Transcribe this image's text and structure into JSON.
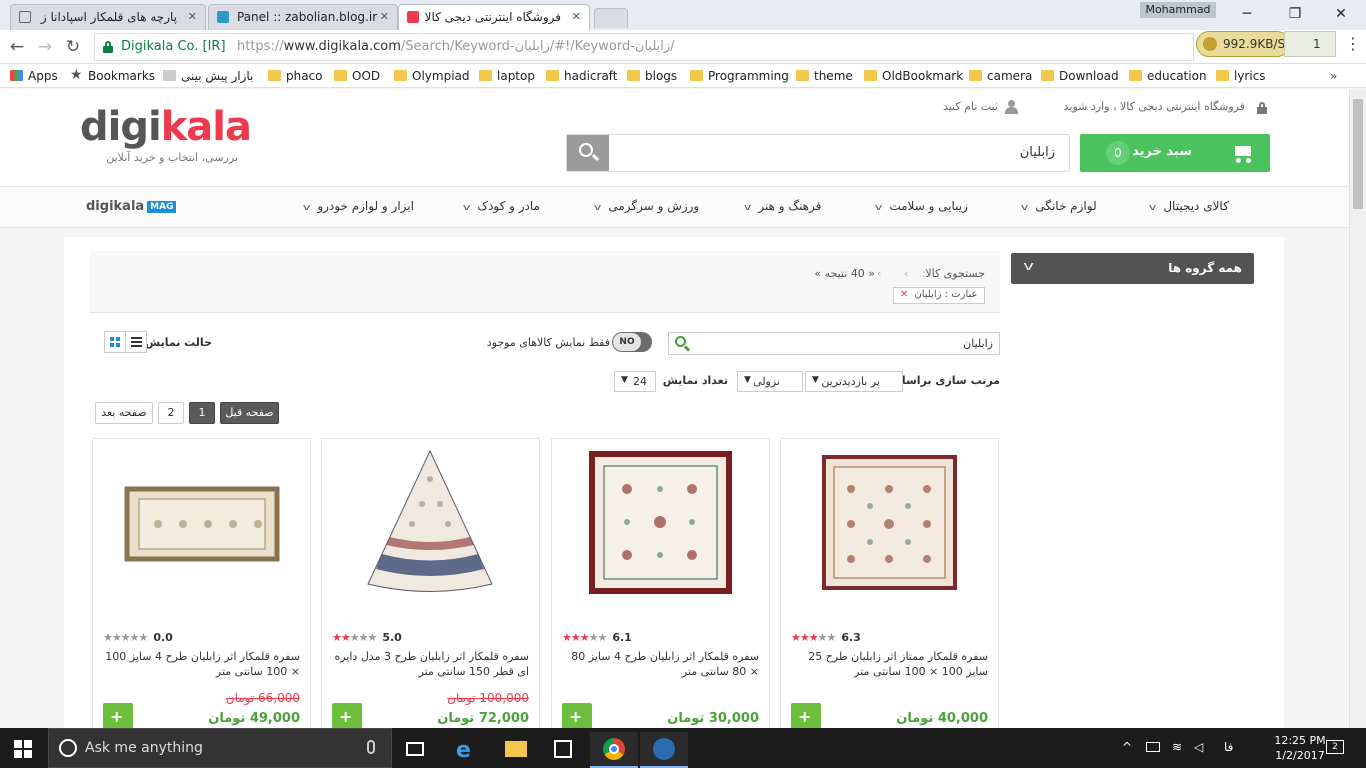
{
  "browser": {
    "tabs": [
      {
        "title": "پارچه های قلمکار اسپادانا ز",
        "icon": "page-icon"
      },
      {
        "title": "Panel :: zabolian.blog.ir",
        "icon": "blog-icon"
      },
      {
        "title": "فروشگاه اینترنتی دیجی کالا",
        "icon": "digikala-icon",
        "active": true
      }
    ],
    "user": "Mohammad",
    "site_identity": "Digikala Co. [IR]",
    "url_scheme": "https://",
    "url_host": "www.digikala.com",
    "url_path": "/Search/Keyword-زابلیان/#!/Keyword-زابلیان/",
    "ext_speed": "992.9KB/S",
    "ext_count": "1",
    "bookmarks": [
      "Apps",
      "Bookmarks",
      "بازار پیش بینی",
      "phaco",
      "OOD",
      "Olympiad",
      "laptop",
      "hadicraft",
      "blogs",
      "Programming",
      "theme",
      "OldBookmark",
      "camera",
      "Download",
      "education",
      "lyrics"
    ]
  },
  "site": {
    "logo_gray": "digi",
    "logo_red": "kala",
    "tagline": "بررسی، انتخاب و خرید آنلاین",
    "login_text": "فروشگاه اینترنتی دیجی کالا ، وارد شوید",
    "register_text": "ثبت نام کنید",
    "search_value": "زابلیان",
    "cart_label": "سبد خرید",
    "cart_count": "0",
    "categories": [
      "کالای دیجیتال",
      "لوازم خانگی",
      "زیبایی و سلامت",
      "فرهنگ و هنر",
      "ورزش و سرگرمی",
      "مادر و کودک",
      "ابزار و لوازم خودرو"
    ],
    "mag_logo": "digikala",
    "mag_badge": "MAG"
  },
  "results": {
    "all_groups": "همه گروه ها",
    "crumb_search": "جستجوی کالا",
    "crumb_count": "« 40 نتیجه »",
    "filter_chip": "عبارت : زابلیان",
    "inner_search": "زابلیان",
    "toggle_state": "NO",
    "toggle_label": "فقط نمایش کالاهای موجود",
    "view_mode_label": "حالت نمایش",
    "sort_label": "مرتب سازی براساس",
    "sort_value": "پر بازدیدترین",
    "order_value": "نزولی",
    "count_label": "تعداد نمایش",
    "count_value": "24",
    "pagination": {
      "prev": "صفحه قبل",
      "pages": [
        "1",
        "2"
      ],
      "next": "صفحه بعد",
      "current": "1"
    },
    "products": [
      {
        "title": "سفره قلمکار ممتاز اثر زابلیان طرح 25 سایز 100 × 100 سانتی متر",
        "rating": "6.3",
        "stars": 3,
        "old_price": "",
        "price": "40,000 تومان"
      },
      {
        "title": "سفره قلمکار اثر زابلیان طرح 4 سایز 80 × 80 سانتی متر",
        "rating": "6.1",
        "stars": 3,
        "old_price": "",
        "price": "30,000 تومان"
      },
      {
        "title": "سفره قلمکار اثر زابلیان طرح 3 مدل دایره ای قطر 150 سانتی متر",
        "rating": "5.0",
        "stars": 2,
        "old_price": "100,000 تومان",
        "price": "72,000 تومان"
      },
      {
        "title": "سفره قلمکار اثر زابلیان طرح 4 سایز 100 × 100 سانتی متر",
        "rating": "0.0",
        "stars": 0,
        "old_price": "66,000 تومان",
        "price": "49,000 تومان"
      }
    ]
  },
  "taskbar": {
    "search_placeholder": "Ask me anything",
    "time": "12:25 PM",
    "date": "1/2/2017",
    "lang": "فا",
    "notifications": "2"
  },
  "colors": {
    "brand_red": "#ef394e",
    "cart_green": "#4ac25d",
    "price_green": "#4aa23a"
  }
}
